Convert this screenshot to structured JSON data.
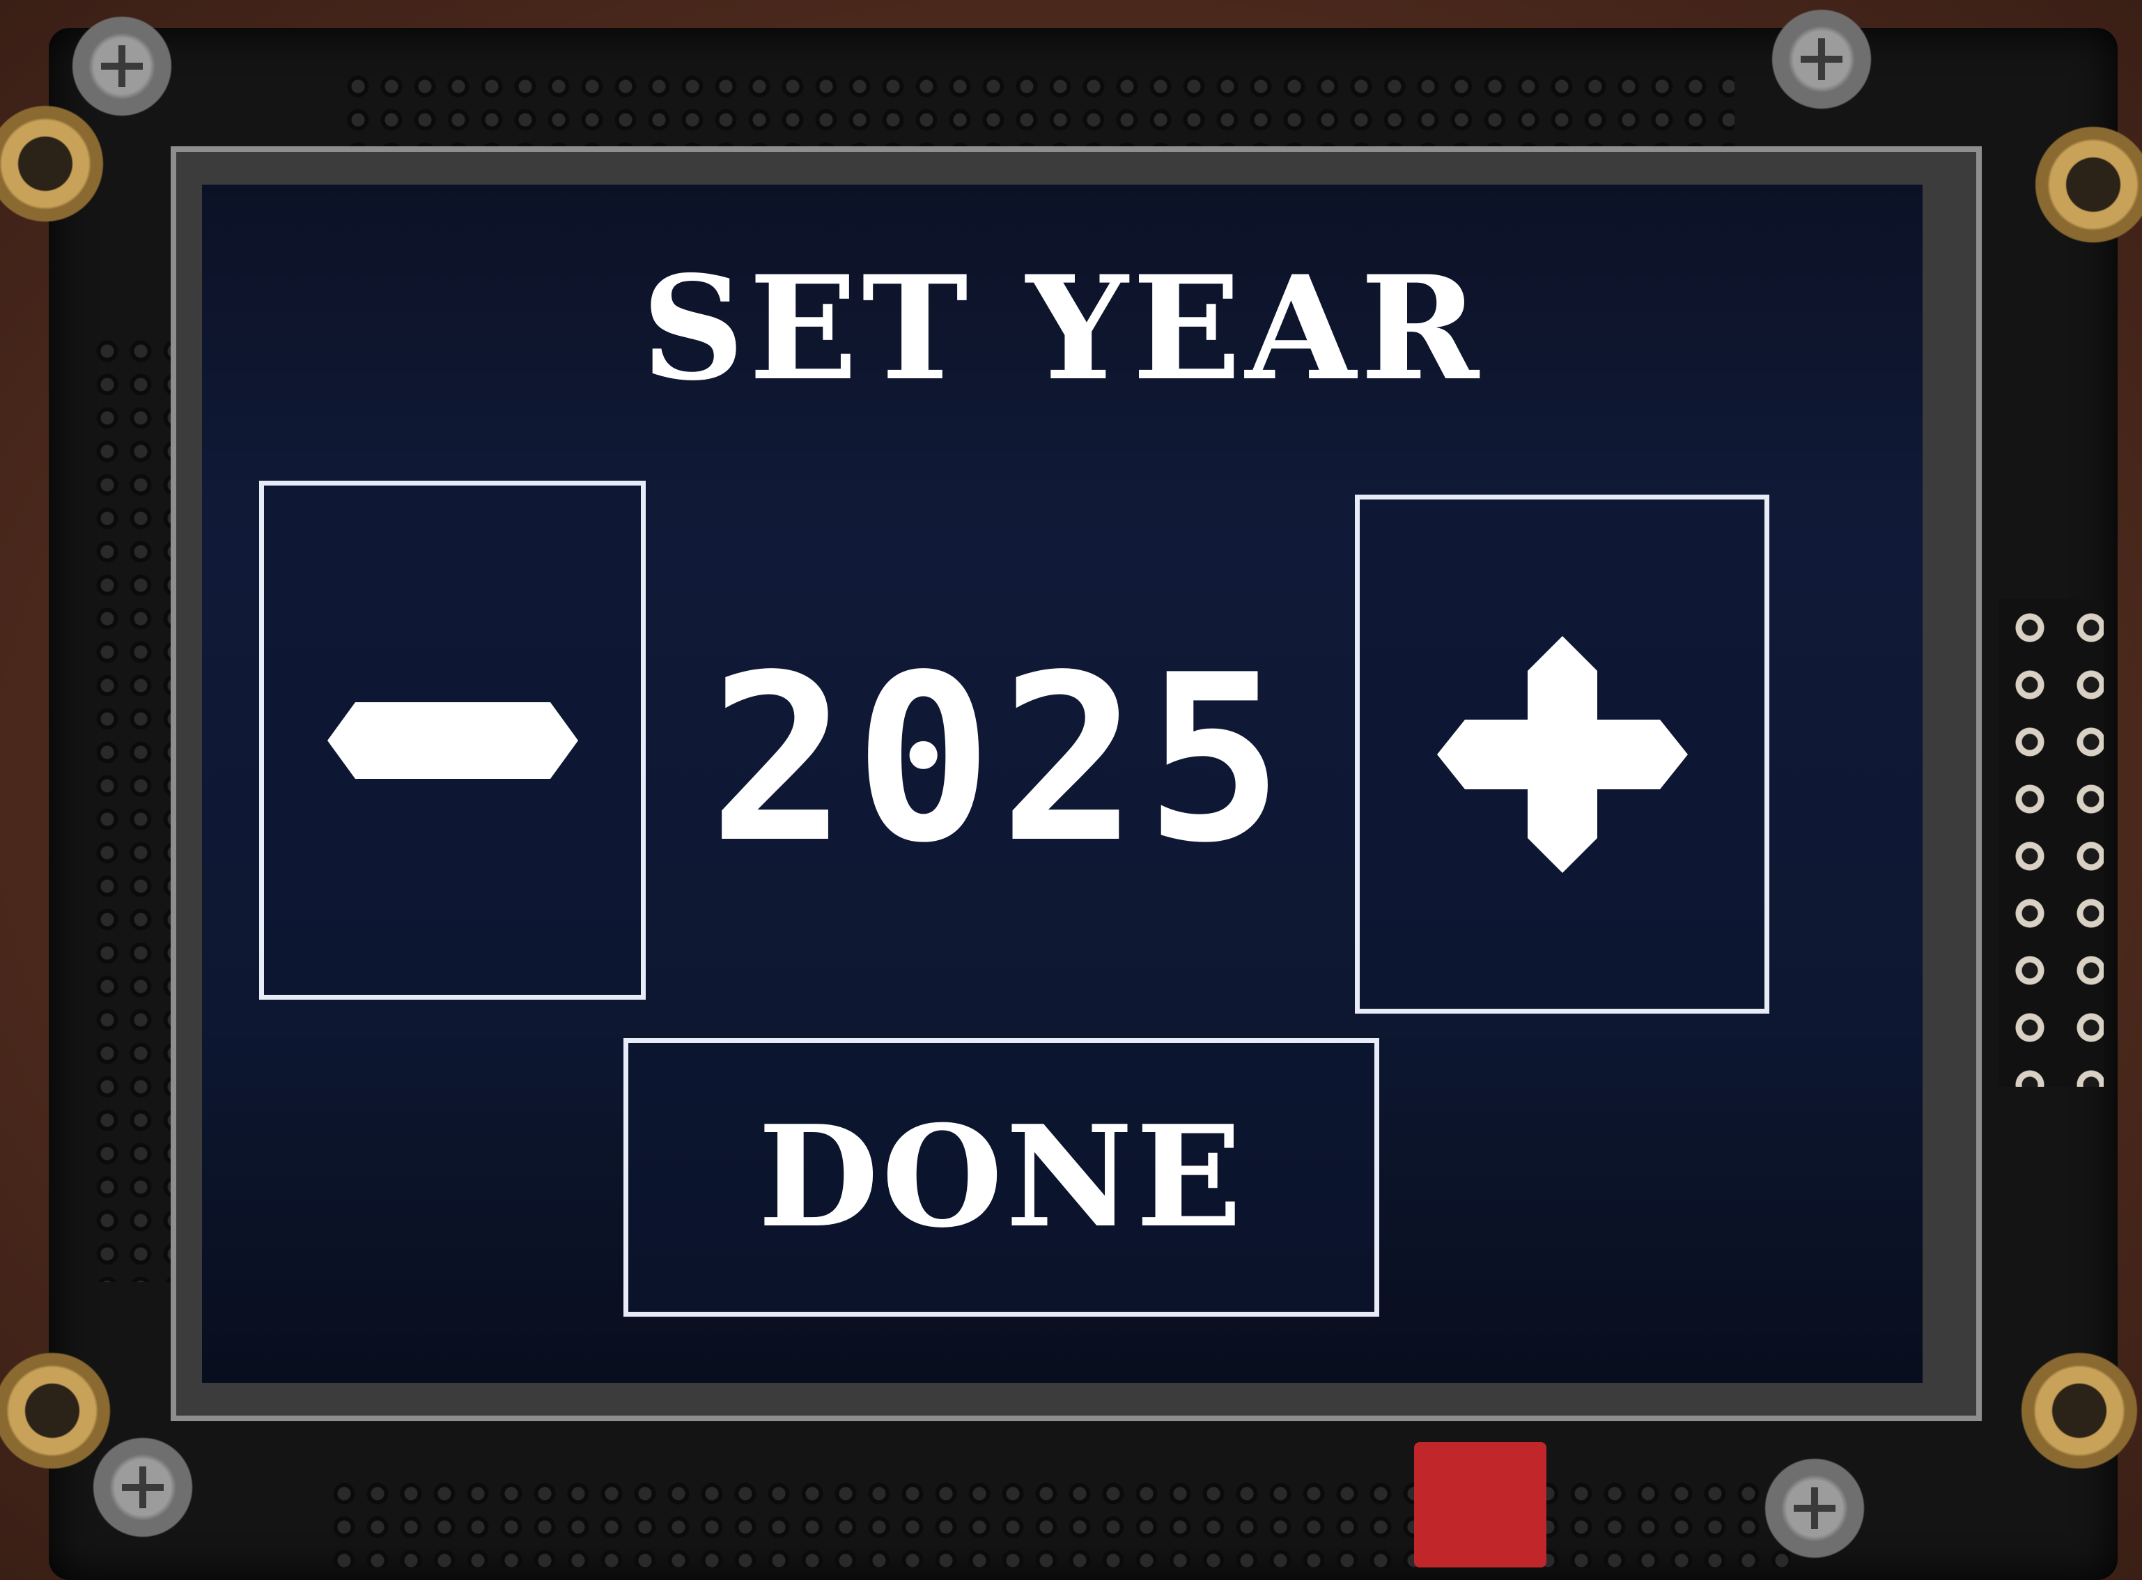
{
  "screen": {
    "title": "SET YEAR",
    "year_value": "2025",
    "decrement_button": {
      "icon": "minus-icon"
    },
    "increment_button": {
      "icon": "plus-icon"
    },
    "done_label": "DONE"
  },
  "colors": {
    "screen_background": "#0d1731",
    "foreground": "#ffffff",
    "button_border": "#e8ecf6"
  }
}
